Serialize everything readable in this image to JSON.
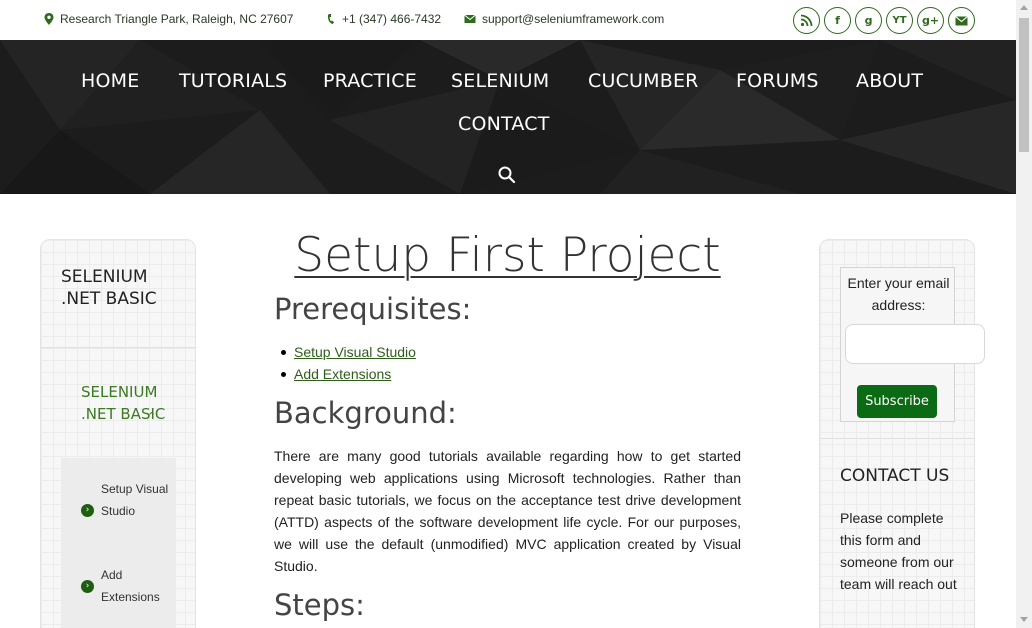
{
  "topbar": {
    "address": "Research Triangle Park, Raleigh, NC 27607",
    "phone": "+1 (347) 466-7432",
    "email": "support@seleniumframework.com",
    "social": [
      {
        "name": "rss-icon",
        "glyph": "◉"
      },
      {
        "name": "facebook-icon",
        "glyph": "f"
      },
      {
        "name": "goodreads-icon",
        "glyph": "g"
      },
      {
        "name": "youtube-icon",
        "glyph": "YT"
      },
      {
        "name": "google-plus-icon",
        "glyph": "g+"
      },
      {
        "name": "mail-icon",
        "glyph": "✉"
      }
    ]
  },
  "nav": {
    "items": [
      "HOME",
      "TUTORIALS",
      "PRACTICE",
      "SELENIUM",
      "CUCUMBER",
      "FORUMS",
      "ABOUT",
      "CONTACT"
    ],
    "search_icon": "search-icon"
  },
  "left_sidebar": {
    "title": "SELENIUM .NET BASIC",
    "section": "SELENIUM .NET BASIC",
    "links": [
      "Setup Visual Studio",
      "Add Extensions"
    ]
  },
  "main": {
    "title": "Setup First Project",
    "prereq_heading": "Prerequisites:",
    "prereq_links": [
      "Setup Visual Studio",
      "Add Extensions"
    ],
    "background_heading": "Background:",
    "background_text": "There are many good tutorials available regarding how to get started developing web applications using Microsoft technologies.  Rather than repeat basic tutorials, we focus on the acceptance test drive development (ATTD) aspects of the software development life cycle.  For our purposes, we will use the default (unmodified) MVC application created by Visual Studio.",
    "steps_heading": "Steps:"
  },
  "right_sidebar": {
    "email_label": "Enter your email address:",
    "subscribe_label": "Subscribe",
    "contact_title": "CONTACT US",
    "contact_text": "Please complete this form and someone from our team will reach out"
  },
  "colors": {
    "accent": "#3a7a22",
    "button": "#0a6b14",
    "hero": "#1d1d1d"
  }
}
